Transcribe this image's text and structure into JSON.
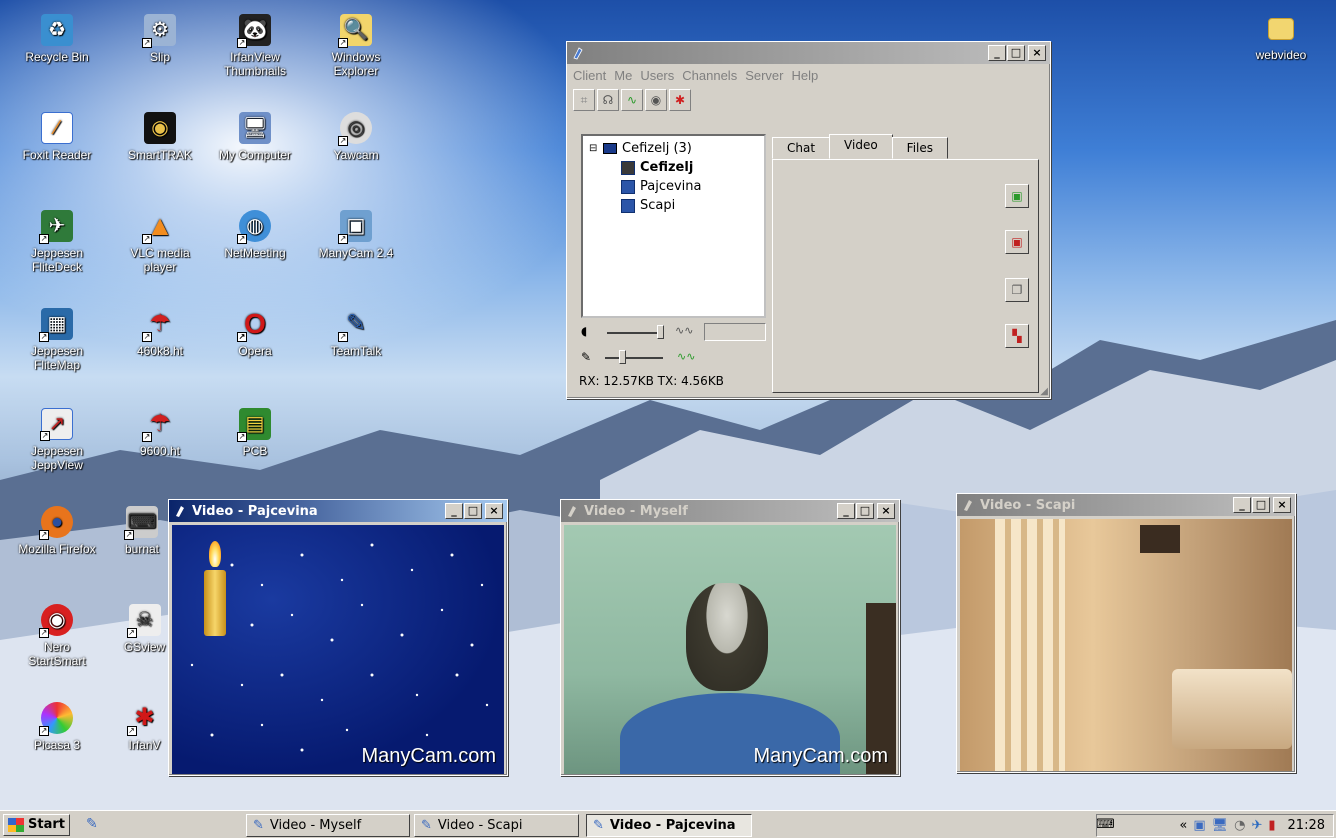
{
  "desktop_icons": [
    {
      "label": "Recycle Bin",
      "icon": "recycle-bin-icon"
    },
    {
      "label": "Slip",
      "icon": "slip-icon"
    },
    {
      "label": "IrfanView Thumbnails",
      "icon": "irfanview-thumbnails-icon"
    },
    {
      "label": "Windows Explorer",
      "icon": "windows-explorer-icon"
    },
    {
      "label": "Foxit Reader",
      "icon": "foxit-reader-icon"
    },
    {
      "label": "SmartTRAK",
      "icon": "smarttrak-icon"
    },
    {
      "label": "My Computer",
      "icon": "my-computer-icon"
    },
    {
      "label": "Yawcam",
      "icon": "yawcam-icon"
    },
    {
      "label": "Jeppesen FliteDeck",
      "icon": "jeppesen-flitedeck-icon"
    },
    {
      "label": "VLC media player",
      "icon": "vlc-icon"
    },
    {
      "label": "NetMeeting",
      "icon": "netmeeting-icon"
    },
    {
      "label": "ManyCam 2.4",
      "icon": "manycam-icon"
    },
    {
      "label": "Jeppesen FliteMap",
      "icon": "jeppesen-flitemap-icon"
    },
    {
      "label": "460k8.ht",
      "icon": "hyperterminal-icon"
    },
    {
      "label": "Opera",
      "icon": "opera-icon"
    },
    {
      "label": "TeamTalk",
      "icon": "teamtalk-icon"
    },
    {
      "label": "Jeppesen JeppView",
      "icon": "jeppesen-jeppview-icon"
    },
    {
      "label": "9600.ht",
      "icon": "hyperterminal-icon"
    },
    {
      "label": "PCB",
      "icon": "pcb-icon"
    },
    {
      "label": "Mozilla Firefox",
      "icon": "firefox-icon"
    },
    {
      "label": "burnat",
      "icon": "burnat-icon"
    },
    {
      "label": "Nero StartSmart",
      "icon": "nero-icon"
    },
    {
      "label": "GSview",
      "icon": "gsview-icon"
    },
    {
      "label": "Picasa 3",
      "icon": "picasa-icon"
    },
    {
      "label": "IrfanV",
      "icon": "irfanview-icon"
    },
    {
      "label": "webvideo",
      "icon": "folder-icon"
    }
  ],
  "teamtalk": {
    "menu": [
      "Client",
      "Me",
      "Users",
      "Channels",
      "Server",
      "Help"
    ],
    "channel": "Cefizelj (3)",
    "users": [
      "Cefizelj",
      "Pajcevina",
      "Scapi"
    ],
    "tabs": [
      "Chat",
      "Video",
      "Files"
    ],
    "selected_tab": "Video",
    "status": "RX: 12.57KB TX: 4.56KB"
  },
  "video_windows": [
    {
      "title": "Video - Pajcevina",
      "watermark": "ManyCam.com"
    },
    {
      "title": "Video - Myself",
      "watermark": "ManyCam.com"
    },
    {
      "title": "Video - Scapi"
    }
  ],
  "window_buttons": {
    "minimize": "_",
    "maximize": "□",
    "close": "×"
  },
  "taskbar": {
    "start_label": "Start",
    "tasks": [
      "Video - Myself",
      "Video - Scapi",
      "Video - Pajcevina"
    ],
    "active_task": "Video - Pajcevina",
    "clock": "21:28",
    "tray_chevron": "«"
  },
  "colors": {
    "title_active": "#0a246a",
    "title_inactive": "#808080",
    "face": "#d4d0c8"
  }
}
